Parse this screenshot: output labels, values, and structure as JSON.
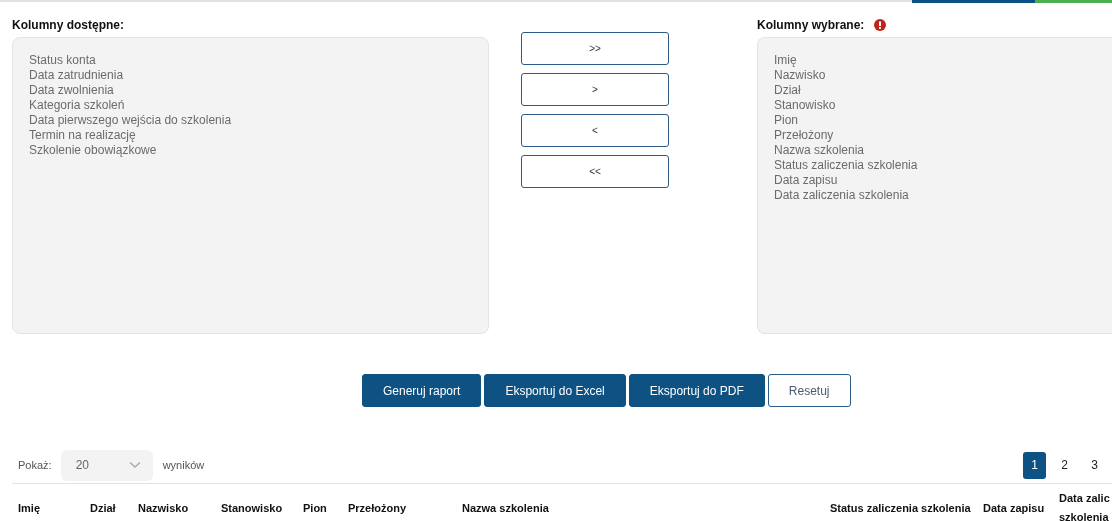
{
  "available": {
    "label": "Kolumny dostępne:",
    "items": [
      "Status konta",
      "Data zatrudnienia",
      "Data zwolnienia",
      "Kategoria szkoleń",
      "Data pierwszego wejścia do szkolenia",
      "Termin na realizację",
      "Szkolenie obowiązkowe"
    ]
  },
  "move_buttons": [
    ">>",
    ">",
    "<",
    "<<"
  ],
  "selected": {
    "label": "Kolumny wybrane:",
    "warning": true,
    "items": [
      "Imię",
      "Nazwisko",
      "Dział",
      "Stanowisko",
      "Pion",
      "Przełożony",
      "Nazwa szkolenia",
      "Status zaliczenia szkolenia",
      "Data zapisu",
      "Data zaliczenia szkolenia"
    ]
  },
  "actions": [
    {
      "label": "Generuj raport",
      "kind": "primary"
    },
    {
      "label": "Eksportuj do Excel",
      "kind": "primary"
    },
    {
      "label": "Eksportuj do PDF",
      "kind": "primary"
    },
    {
      "label": "Resetuj",
      "kind": "outline"
    }
  ],
  "page_size": {
    "label": "Pokaż:",
    "value": "20",
    "suffix": "wyników"
  },
  "pages": [
    {
      "label": "1",
      "selected": true
    },
    {
      "label": "2",
      "selected": false
    },
    {
      "label": "3",
      "selected": false
    }
  ],
  "table": {
    "columns": [
      "Imię",
      "Dział",
      "Nazwisko",
      "Stanowisko",
      "Pion",
      "Przełożony",
      "Nazwa szkolenia",
      "Status zaliczenia szkolenia",
      "Data zapisu",
      "Data zalic szkolenia"
    ]
  }
}
